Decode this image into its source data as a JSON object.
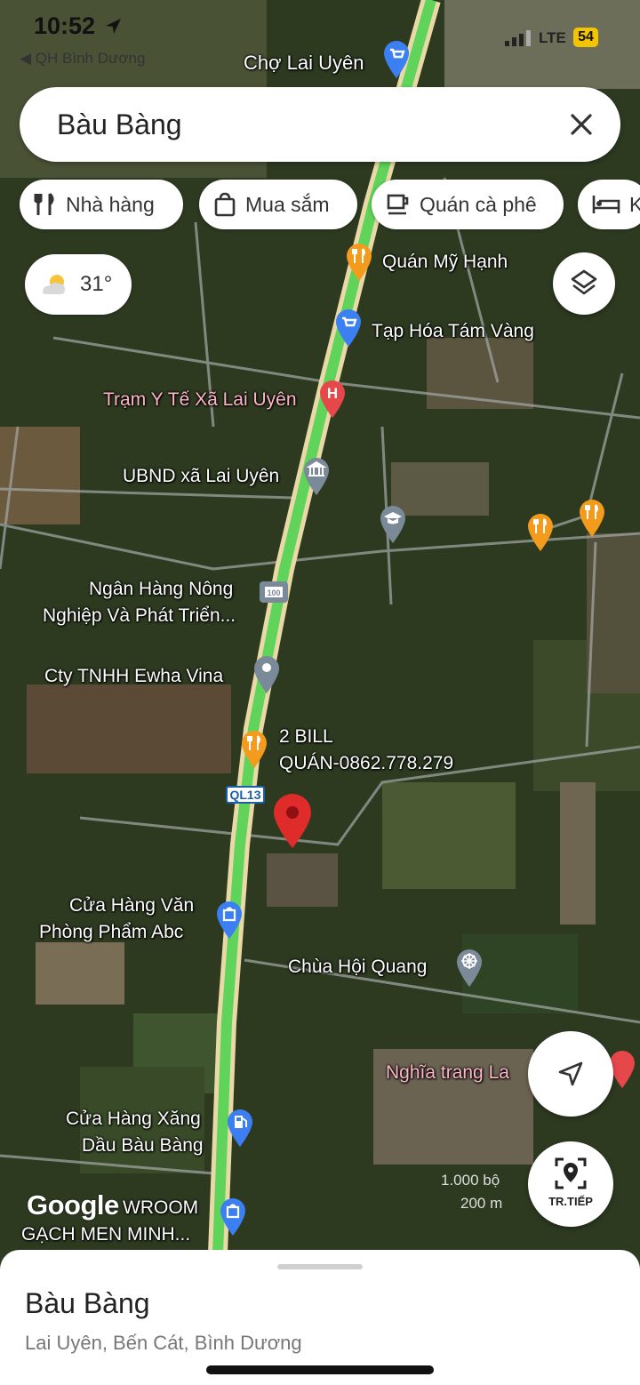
{
  "status_bar": {
    "time": "10:52",
    "back_app": "◀ QH Bình Dương",
    "network": "LTE",
    "battery": "54"
  },
  "search": {
    "query": "Bàu Bàng"
  },
  "chips": [
    {
      "label": "Nhà hàng",
      "icon": "restaurant-icon"
    },
    {
      "label": "Mua sắm",
      "icon": "shopping-bag-icon"
    },
    {
      "label": "Quán cà phê",
      "icon": "coffee-icon"
    },
    {
      "label": "K",
      "icon": "hotel-icon"
    }
  ],
  "weather": {
    "temperature": "31°",
    "icon": "partly-sunny-icon"
  },
  "map": {
    "route_sign": "QL13",
    "google_logo": "Google",
    "scale": {
      "top": "1.000 bộ",
      "bottom": "200 m"
    },
    "places": {
      "cho_lai_uyen": "Chợ Lai Uyên",
      "quan_my_hanh": "Quán Mỹ Hạnh",
      "tap_hoa": "Tạp Hóa Tám Vàng",
      "tram_y_te": "Trạm Y Tế Xã Lai Uyên",
      "ubnd": "UBND xã Lai Uyên",
      "ngan_hang_1": "Ngân Hàng Nông",
      "ngan_hang_2": "Nghiệp Và Phát Triển...",
      "ewha": "Cty TNHH Ewha Vina",
      "bill_1": "2 BILL",
      "bill_2": "QUÁN-0862.778.279",
      "van_phong_1": "Cửa Hàng Văn",
      "van_phong_2": "Phòng Phẩm Abc",
      "chua": "Chùa Hội Quang",
      "nghia_trang": "Nghĩa trang La",
      "xang_1": "Cửa Hàng Xăng",
      "xang_2": "Dầu Bàu Bàng",
      "gach_1": "WROOM",
      "gach_2": "GẠCH MEN MINH..."
    },
    "colors": {
      "road_traffic": "#5fd35a",
      "restaurant_pin": "#f29b1d",
      "shop_pin": "#3b7ff2",
      "hospital_pin": "#e6474a",
      "generic_pin": "#7a8a99",
      "selected_pin": "#e02b2b"
    }
  },
  "buttons": {
    "directions_label": "TR.TIẾP"
  },
  "sheet": {
    "title": "Bàu Bàng",
    "address": "Lai Uyên, Bến Cát, Bình Dương"
  }
}
